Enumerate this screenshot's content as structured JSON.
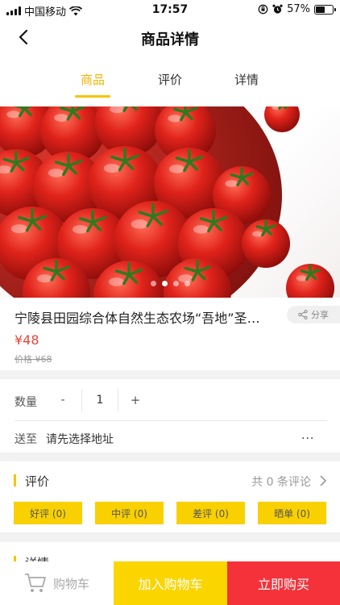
{
  "status_bar": {
    "carrier": "中国移动",
    "time": "17:57",
    "battery": "57%",
    "battery_level": 0.57
  },
  "header": {
    "title": "商品详情"
  },
  "tabs": [
    {
      "label": "商品",
      "active": true
    },
    {
      "label": "评价",
      "active": false
    },
    {
      "label": "详情",
      "active": false
    }
  ],
  "gallery": {
    "slide_count": 4,
    "active_index": 1
  },
  "product": {
    "name": "宁陵县田园综合体自然生态农场“吾地”圣…",
    "share_label": "分享",
    "price": "¥48",
    "original_price": "价格 ¥68"
  },
  "options": {
    "quantity_label": "数量",
    "minus": "-",
    "quantity": "1",
    "plus": "+",
    "ship_label": "送至",
    "address_placeholder": "请先选择地址",
    "more": "..."
  },
  "reviews": {
    "title": "评价",
    "count_text": "共 0 条评论",
    "filters": [
      "好评 (0)",
      "中评 (0)",
      "差评 (0)",
      "晒单 (0)"
    ]
  },
  "details": {
    "title": "详情"
  },
  "bottom_bar": {
    "cart": "购物车",
    "add_to_cart": "加入购物车",
    "buy_now": "立即购买"
  },
  "colors": {
    "accent_yellow": "#f5c400",
    "buy_red": "#f5323a",
    "price_red": "#e8463b"
  }
}
